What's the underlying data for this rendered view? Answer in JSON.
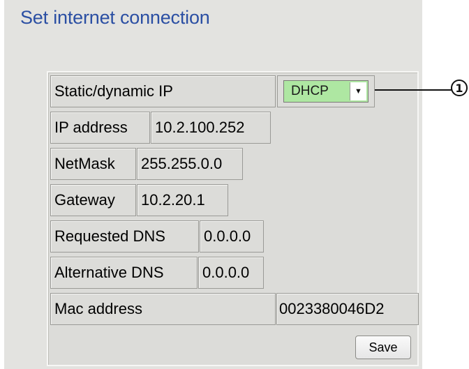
{
  "page": {
    "title": "Set internet connection"
  },
  "form": {
    "ip_mode": {
      "label": "Static/dynamic IP",
      "value": "DHCP"
    },
    "ip_address": {
      "label": "IP address",
      "value": "10.2.100.252"
    },
    "netmask": {
      "label": "NetMask",
      "value": "255.255.0.0"
    },
    "gateway": {
      "label": "Gateway",
      "value": "10.2.20.1"
    },
    "requested_dns": {
      "label": "Requested DNS",
      "value": "0.0.0.0"
    },
    "alternative_dns": {
      "label": "Alternative DNS",
      "value": "0.0.0.0"
    },
    "mac_address": {
      "label": "Mac address",
      "value": "0023380046D2"
    },
    "save_label": "Save"
  },
  "callout": {
    "number": "1"
  },
  "colors": {
    "title": "#2b4fa3",
    "select_bg": "#aee7a2",
    "panel_bg": "#e3e3e0"
  },
  "icons": {
    "dropdown": "chevron-down-icon"
  }
}
